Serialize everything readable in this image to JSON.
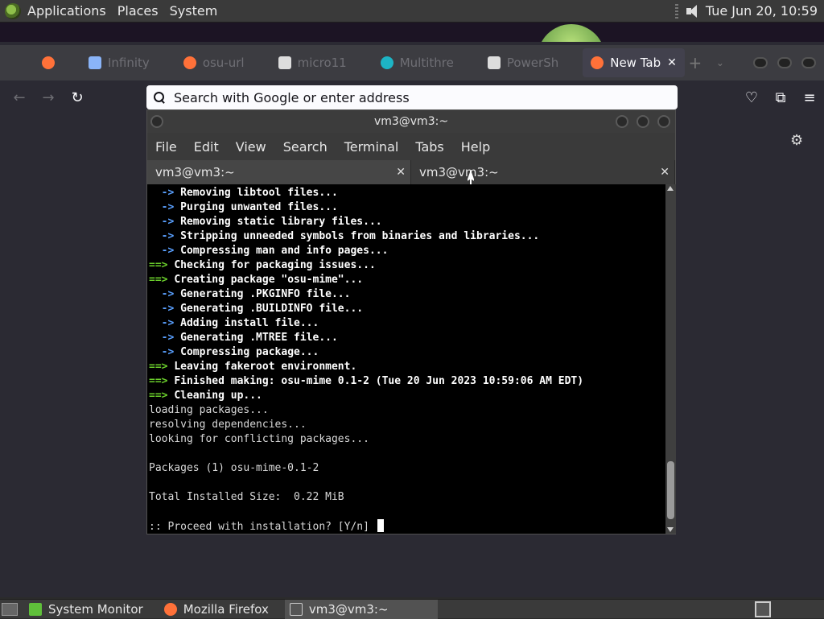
{
  "top_panel": {
    "menus": [
      "Applications",
      "Places",
      "System"
    ],
    "clock": "Tue Jun 20, 10:59"
  },
  "firefox": {
    "tabs": [
      {
        "label": "",
        "icon": "firefox-icon",
        "color": "#ff7139"
      },
      {
        "label": "Infinity",
        "icon": "page-icon",
        "color": "#8ab4f8"
      },
      {
        "label": "osu-url",
        "icon": "firefox-icon",
        "color": "#ff7139"
      },
      {
        "label": "micro11",
        "icon": "museum-icon",
        "color": "#dddddd"
      },
      {
        "label": "Multithre",
        "icon": "gear-icon",
        "color": "#1db4c4"
      },
      {
        "label": "PowerSh",
        "icon": "puzzle-icon",
        "color": "#dddddd"
      },
      {
        "label": "New Tab",
        "icon": "firefox-icon",
        "color": "#ff7139",
        "active": true
      }
    ],
    "url_placeholder": "Search with Google or enter address"
  },
  "terminal": {
    "title": "vm3@vm3:~",
    "menu": [
      "File",
      "Edit",
      "View",
      "Search",
      "Terminal",
      "Tabs",
      "Help"
    ],
    "tabs": [
      "vm3@vm3:~",
      "vm3@vm3:~"
    ],
    "lines": [
      {
        "prefix": "  -> ",
        "kind": "arrow",
        "text": "Removing libtool files..."
      },
      {
        "prefix": "  -> ",
        "kind": "arrow",
        "text": "Purging unwanted files..."
      },
      {
        "prefix": "  -> ",
        "kind": "arrow",
        "text": "Removing static library files..."
      },
      {
        "prefix": "  -> ",
        "kind": "arrow",
        "text": "Stripping unneeded symbols from binaries and libraries..."
      },
      {
        "prefix": "  -> ",
        "kind": "arrow",
        "text": "Compressing man and info pages..."
      },
      {
        "prefix": "==> ",
        "kind": "garrow",
        "text": "Checking for packaging issues..."
      },
      {
        "prefix": "==> ",
        "kind": "garrow",
        "text": "Creating package \"osu-mime\"..."
      },
      {
        "prefix": "  -> ",
        "kind": "arrow",
        "text": "Generating .PKGINFO file..."
      },
      {
        "prefix": "  -> ",
        "kind": "arrow",
        "text": "Generating .BUILDINFO file..."
      },
      {
        "prefix": "  -> ",
        "kind": "arrow",
        "text": "Adding install file..."
      },
      {
        "prefix": "  -> ",
        "kind": "arrow",
        "text": "Generating .MTREE file..."
      },
      {
        "prefix": "  -> ",
        "kind": "arrow",
        "text": "Compressing package..."
      },
      {
        "prefix": "==> ",
        "kind": "garrow",
        "text": "Leaving fakeroot environment."
      },
      {
        "prefix": "==> ",
        "kind": "garrow",
        "text": "Finished making: osu-mime 0.1-2 (Tue 20 Jun 2023 10:59:06 AM EDT)"
      },
      {
        "prefix": "==> ",
        "kind": "garrow",
        "text": "Cleaning up..."
      },
      {
        "prefix": "",
        "kind": "plain",
        "text": "loading packages..."
      },
      {
        "prefix": "",
        "kind": "plain",
        "text": "resolving dependencies..."
      },
      {
        "prefix": "",
        "kind": "plain",
        "text": "looking for conflicting packages..."
      },
      {
        "prefix": "",
        "kind": "plain",
        "text": ""
      },
      {
        "prefix": "",
        "kind": "plain",
        "text": "Packages (1) osu-mime-0.1-2"
      },
      {
        "prefix": "",
        "kind": "plain",
        "text": ""
      },
      {
        "prefix": "",
        "kind": "plain",
        "text": "Total Installed Size:  0.22 MiB"
      },
      {
        "prefix": "",
        "kind": "plain",
        "text": ""
      },
      {
        "prefix": "",
        "kind": "plain",
        "text": ":: Proceed with installation? [Y/n] "
      }
    ]
  },
  "taskbar": {
    "tasks": [
      {
        "label": "System Monitor",
        "icon": "system-monitor-icon",
        "color": "#5fbf3a"
      },
      {
        "label": "Mozilla Firefox",
        "icon": "firefox-icon",
        "color": "#ff7139"
      },
      {
        "label": "vm3@vm3:~",
        "icon": "terminal-icon",
        "color": "#cccccc",
        "active": true
      }
    ]
  }
}
